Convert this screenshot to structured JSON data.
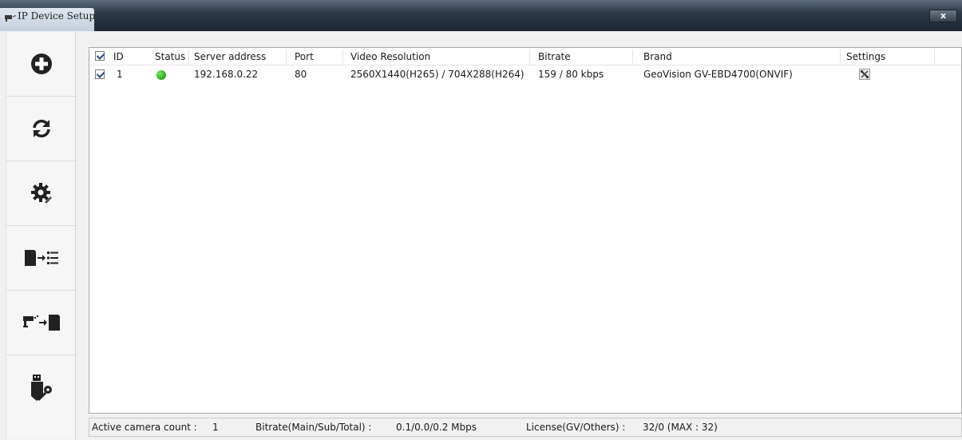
{
  "window": {
    "title": "IP Device Setup",
    "close_label": "x"
  },
  "sidebar": {
    "items": [
      {
        "name": "add",
        "icon": "add-circle-icon"
      },
      {
        "name": "refresh",
        "icon": "refresh-icon"
      },
      {
        "name": "settings",
        "icon": "gear-icon"
      },
      {
        "name": "export",
        "icon": "export-to-list-icon"
      },
      {
        "name": "import",
        "icon": "camera-import-icon"
      },
      {
        "name": "usb-key",
        "icon": "usb-key-icon"
      }
    ]
  },
  "table": {
    "columns": [
      "ID",
      "Status",
      "Server address",
      "Port",
      "Video Resolution",
      "Bitrate",
      "Brand",
      "Settings"
    ],
    "rows": [
      {
        "checked": true,
        "id": "1",
        "status": "online",
        "status_color": "#35b128",
        "server_address": "192.168.0.22",
        "port": "80",
        "video_resolution": "2560X1440(H265) / 704X288(H264)",
        "bitrate": "159 / 80 kbps",
        "brand": "GeoVision GV-EBD4700(ONVIF)",
        "settings_icon": "tools-icon"
      }
    ]
  },
  "statusbar": {
    "active_label": "Active camera count :",
    "active_value": "1",
    "bitrate_label": "Bitrate(Main/Sub/Total) :",
    "bitrate_value": "0.1/0.0/0.2 Mbps",
    "license_label": "License(GV/Others) :",
    "license_value": "32/0 (MAX : 32)"
  }
}
